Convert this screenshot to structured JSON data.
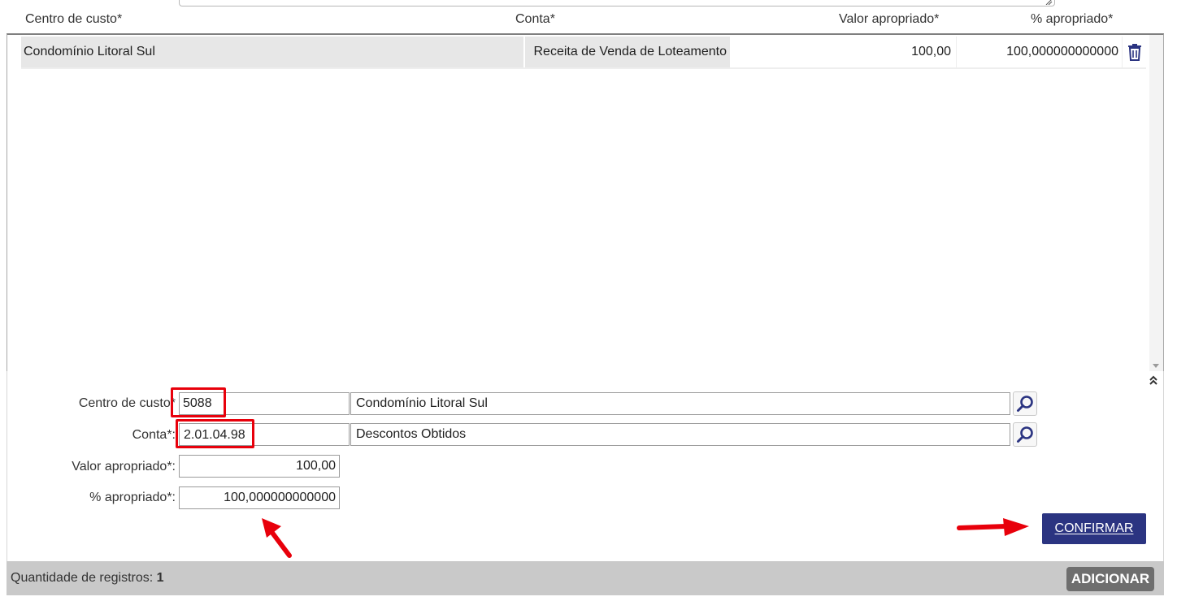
{
  "grid": {
    "columns": [
      "Centro de custo*",
      "Conta*",
      "Valor apropriado*",
      "% apropriado*"
    ],
    "rows": [
      {
        "centro_de_custo": "Condomínio Litoral Sul",
        "conta": "Receita de Venda de Loteamento",
        "valor_apropriado": "100,00",
        "percentual_apropriado": "100,000000000000"
      }
    ],
    "row_icon": "trash-icon"
  },
  "form": {
    "centro_de_custo_label": "Centro de custo*",
    "centro_de_custo_code": "5088",
    "centro_de_custo_desc": "Condomínio Litoral Sul",
    "conta_label": "Conta*:",
    "conta_code": "2.01.04.98",
    "conta_desc": "Descontos Obtidos",
    "valor_label": "Valor apropriado*:",
    "valor_value": "100,00",
    "percentual_label": "% apropriado*:",
    "percentual_value": "100,000000000000",
    "lookup_icon": "search-icon",
    "collapse_icon": "double-chevron-up-icon",
    "confirm_label": "CONFIRMAR"
  },
  "footer": {
    "count_label": "Quantidade de registros:",
    "count_value": "1",
    "add_label": "ADICIONAR"
  },
  "colors": {
    "highlight": "#e8000b",
    "confirm_button": "#2b3481",
    "add_button": "#6e6e6e",
    "footer_bar": "#c9c9c9",
    "row_shade": "#e7e7e7",
    "icon": "#2b3481"
  }
}
